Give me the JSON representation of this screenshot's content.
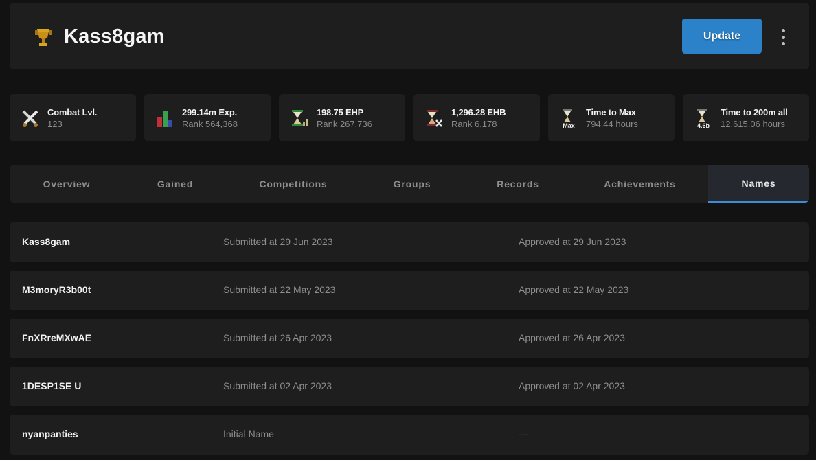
{
  "header": {
    "player_name": "Kass8gam",
    "icon": "trophy-icon",
    "update_label": "Update",
    "menu_icon": "kebab-menu-icon",
    "accent_color": "#2b82c9"
  },
  "stats": [
    {
      "icon": "crossed-swords-icon",
      "label": "Combat Lvl.",
      "value": "123"
    },
    {
      "icon": "bar-chart-icon",
      "label": "299.14m Exp.",
      "value": "Rank 564,368"
    },
    {
      "icon": "hourglass-ehp-icon",
      "label": "198.75 EHP",
      "value": "Rank 267,736"
    },
    {
      "icon": "hourglass-ehb-icon",
      "label": "1,296.28 EHB",
      "value": "Rank 6,178"
    },
    {
      "icon": "hourglass-max-icon",
      "label": "Time to Max",
      "value": "794.44 hours",
      "icon_text": "Max"
    },
    {
      "icon": "hourglass-200m-icon",
      "label": "Time to 200m all",
      "value": "12,615.06 hours",
      "icon_text": "4.6b"
    }
  ],
  "tabs": [
    {
      "label": "Overview",
      "active": false
    },
    {
      "label": "Gained",
      "active": false
    },
    {
      "label": "Competitions",
      "active": false
    },
    {
      "label": "Groups",
      "active": false
    },
    {
      "label": "Records",
      "active": false
    },
    {
      "label": "Achievements",
      "active": false
    },
    {
      "label": "Names",
      "active": true
    }
  ],
  "names": [
    {
      "name": "Kass8gam",
      "submitted": "Submitted at 29 Jun 2023",
      "approved": "Approved at 29 Jun 2023"
    },
    {
      "name": "M3moryR3b00t",
      "submitted": "Submitted at 22 May 2023",
      "approved": "Approved at 22 May 2023"
    },
    {
      "name": "FnXRreMXwAE",
      "submitted": "Submitted at 26 Apr 2023",
      "approved": "Approved at 26 Apr 2023"
    },
    {
      "name": "1DESP1SE U",
      "submitted": "Submitted at 02 Apr 2023",
      "approved": "Approved at 02 Apr 2023"
    },
    {
      "name": "nyanpanties",
      "submitted": "Initial Name",
      "approved": "---"
    }
  ]
}
